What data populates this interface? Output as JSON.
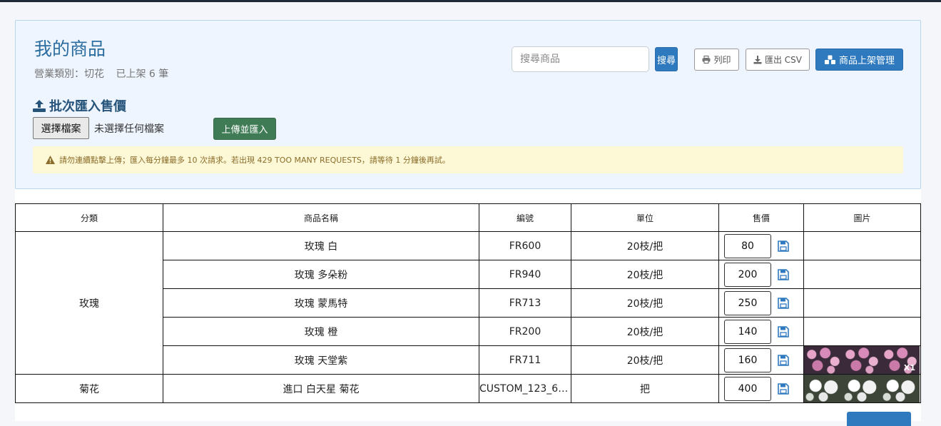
{
  "header": {
    "title": "我的商品",
    "category_label": "營業類別：切花",
    "listed_label": "已上架 6 筆"
  },
  "toolbar": {
    "search_placeholder": "搜尋商品",
    "search_label": "搜尋",
    "print_label": "列印",
    "export_label": "匯出 CSV",
    "manage_label": "商品上架管理"
  },
  "import": {
    "title": "批次匯入售價",
    "choose_file_label": "選擇檔案",
    "file_status": "未選擇任何檔案",
    "upload_label": "上傳並匯入",
    "warning": "請勿連續點擊上傳；匯入每分鐘最多 10 次請求。若出現 429 TOO MANY REQUESTS，請等待 1 分鐘後再試。"
  },
  "table": {
    "headers": [
      "分類",
      "商品名稱",
      "編號",
      "單位",
      "售價",
      "圖片"
    ],
    "groups": [
      {
        "category": "玫瑰",
        "rows": [
          {
            "name": "玫瑰 白",
            "code": "FR600",
            "unit": "20枝/把",
            "price": "80"
          },
          {
            "name": "玫瑰 多朵粉",
            "code": "FR940",
            "unit": "20枝/把",
            "price": "200"
          },
          {
            "name": "玫瑰 蒙馬特",
            "code": "FR713",
            "unit": "20枝/把",
            "price": "250"
          },
          {
            "name": "玫瑰 橙",
            "code": "FR200",
            "unit": "20枝/把",
            "price": "140"
          },
          {
            "name": "玫瑰 天堂紫",
            "code": "FR711",
            "unit": "20枝/把",
            "price": "160",
            "image_count": "X1"
          }
        ]
      },
      {
        "category": "菊花",
        "rows": [
          {
            "name": "進口 白天星 菊花",
            "code": "CUSTOM_123_6a8e...",
            "unit": "把",
            "price": "400"
          }
        ]
      }
    ]
  },
  "colors": {
    "primary": "#2f7abf",
    "success": "#3f7b55",
    "panel_bg": "#eef5fe",
    "warning_bg": "#fdf8d6"
  }
}
